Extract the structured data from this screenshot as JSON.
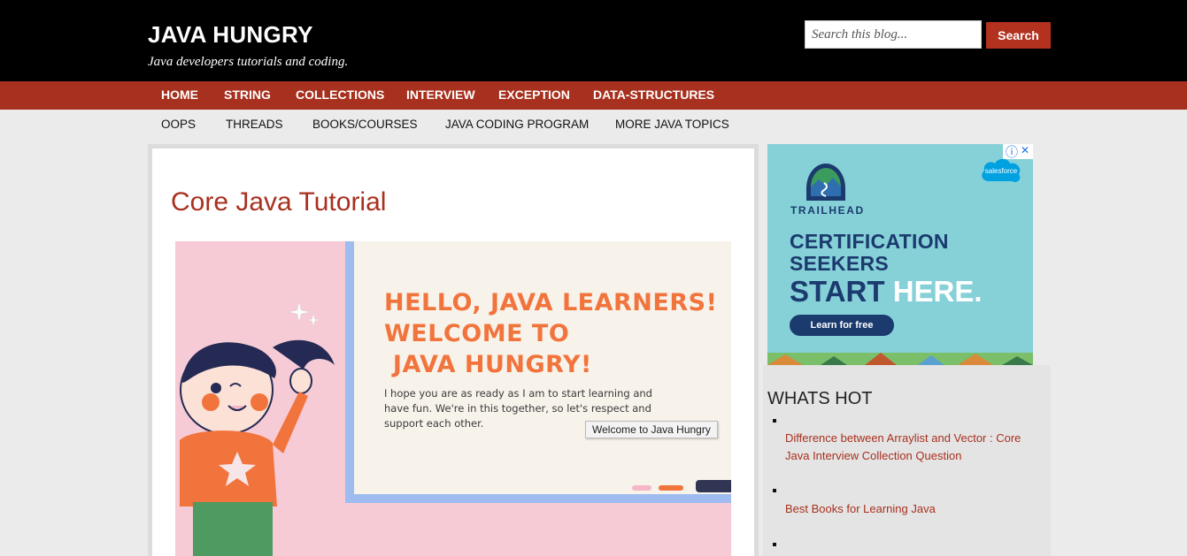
{
  "header": {
    "site_title": "JAVA HUNGRY",
    "site_description": "Java developers tutorials and coding.",
    "search_placeholder": "Search this blog...",
    "search_button": "Search"
  },
  "primary_nav": [
    "HOME",
    "STRING",
    "COLLECTIONS",
    "INTERVIEW",
    "EXCEPTION",
    "DATA-STRUCTURES"
  ],
  "secondary_nav": [
    "OOPS",
    "THREADS",
    "BOOKS/COURSES",
    "JAVA CODING PROGRAM",
    "MORE JAVA TOPICS"
  ],
  "post": {
    "title": "Core Java Tutorial",
    "hero": {
      "headline": [
        "HELLO, JAVA LEARNERS!",
        "WELCOME TO",
        " JAVA HUNGRY!"
      ],
      "paragraph": [
        "I hope you are as ready as I am to start learning and",
        "have fun.  We're in this together, so let's respect and",
        "support each other."
      ],
      "tooltip": "Welcome to Java Hungry"
    }
  },
  "ad": {
    "brand": "TRAILHEAD",
    "logo_text": "salesforce",
    "line1": "CERTIFICATION",
    "line2": "SEEKERS",
    "start_word1": "START",
    "start_word2": "HERE.",
    "cta": "Learn for free",
    "info_icon": "ⓘ",
    "close_icon": "✕"
  },
  "sidebar": {
    "title": "WHATS HOT",
    "links": [
      "Difference between Arraylist and Vector : Core Java Interview Collection Question",
      "Best Books for Learning Java"
    ]
  },
  "colors": {
    "header_bg": "#000000",
    "accent_red": "#a8301e",
    "page_bg": "#ebebeb",
    "ad_bg": "#86d1d8",
    "ad_navy": "#1b3a6e",
    "hero_pink": "#f6cbd6",
    "hero_orange": "#f2743d"
  }
}
